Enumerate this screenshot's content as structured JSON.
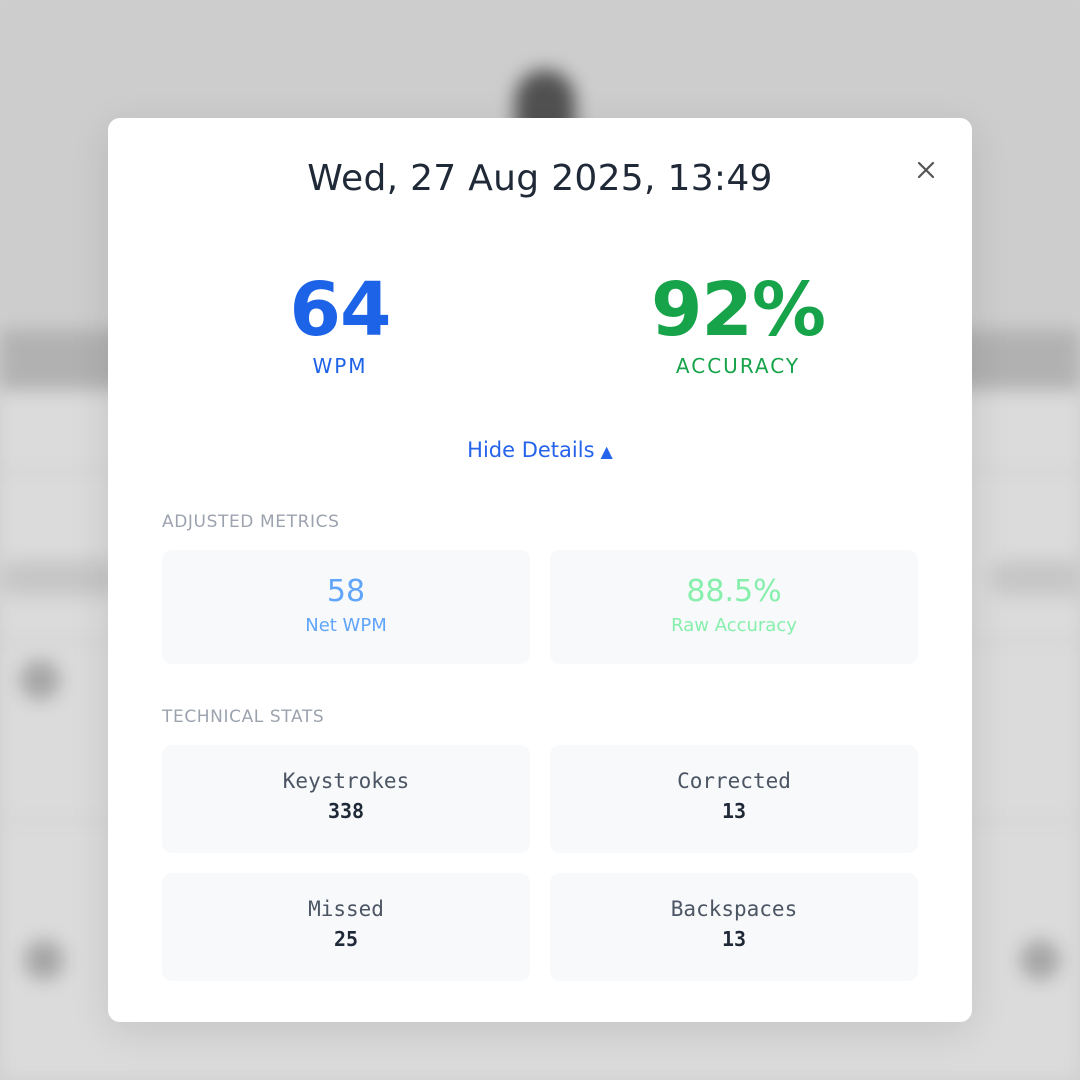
{
  "modal": {
    "title": "Wed, 27 Aug 2025, 13:49",
    "close_label": "×"
  },
  "hero": {
    "wpm_value": "64",
    "wpm_label": "WPM",
    "accuracy_value": "92%",
    "accuracy_label": "ACCURACY"
  },
  "details_toggle": {
    "label": "Hide Details",
    "arrow": "▲"
  },
  "adjusted_metrics": {
    "title": "ADJUSTED METRICS",
    "net_wpm_value": "58",
    "net_wpm_label": "Net WPM",
    "raw_accuracy_value": "88.5%",
    "raw_accuracy_label": "Raw Accuracy"
  },
  "technical_stats": {
    "title": "TECHNICAL STATS",
    "items": [
      {
        "label": "Keystrokes",
        "value": "338"
      },
      {
        "label": "Corrected",
        "value": "13"
      },
      {
        "label": "Missed",
        "value": "25"
      },
      {
        "label": "Backspaces",
        "value": "13"
      }
    ]
  },
  "colors": {
    "wpm_blue": "#1d63e8",
    "accuracy_green": "#16a34a",
    "link_blue": "#2563eb",
    "net_wpm_light_blue": "#60a5fa",
    "raw_accuracy_light_green": "#86efac"
  },
  "icons": {
    "close": "close-icon"
  }
}
